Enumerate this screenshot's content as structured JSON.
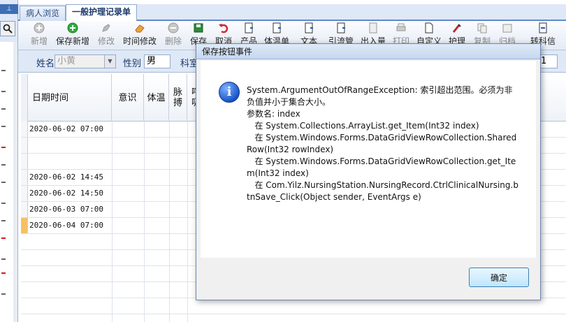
{
  "tabs": [
    {
      "label": "病人浏览"
    },
    {
      "label": "一般护理记录单"
    }
  ],
  "toolbar": [
    {
      "label": "新增",
      "icon": "add-gray-icon",
      "enabled": false
    },
    {
      "label": "保存新增",
      "icon": "add-green-icon",
      "enabled": true
    },
    {
      "label": "修改",
      "icon": "edit-icon",
      "enabled": false
    },
    {
      "label": "时间修改",
      "icon": "eraser-icon",
      "enabled": true
    },
    {
      "label": "删除",
      "icon": "delete-icon",
      "enabled": false
    },
    {
      "label": "保存",
      "icon": "save-icon",
      "enabled": true
    },
    {
      "label": "取消",
      "icon": "undo-icon",
      "enabled": true
    },
    {
      "label": "产品",
      "icon": "product-icon",
      "enabled": true
    },
    {
      "label": "体温单",
      "icon": "temperature-icon",
      "enabled": true
    },
    {
      "label": "文本",
      "icon": "text-icon",
      "enabled": true
    },
    {
      "label": "引流管",
      "icon": "drain-icon",
      "enabled": true
    },
    {
      "label": "出入量",
      "icon": "io-icon",
      "enabled": false
    },
    {
      "label": "打印",
      "icon": "print-icon",
      "enabled": false
    },
    {
      "label": "自定义",
      "icon": "custom-icon",
      "enabled": true
    },
    {
      "label": "护理",
      "icon": "nursing-icon",
      "enabled": true
    },
    {
      "label": "复制",
      "icon": "copy-icon",
      "enabled": false
    },
    {
      "label": "归档",
      "icon": "archive-icon",
      "enabled": false
    },
    {
      "label": "转科信",
      "icon": "transfer-icon",
      "enabled": true
    }
  ],
  "patient": {
    "name_label": "姓名",
    "name_value": "小黄",
    "sex_label": "性别",
    "sex_value": "男",
    "dept_label": "科室",
    "right_value": "1"
  },
  "grid": {
    "columns": [
      "日期时间",
      "意识",
      "体温",
      "脉搏",
      "呼吸"
    ],
    "rows": [
      {
        "datetime": "2020-06-02 07:00"
      },
      {
        "datetime": ""
      },
      {
        "datetime": ""
      },
      {
        "datetime": "2020-06-02 14:45"
      },
      {
        "datetime": "2020-06-02 14:50"
      },
      {
        "datetime": "2020-06-03 07:00"
      },
      {
        "datetime": "2020-06-04 07:00"
      }
    ]
  },
  "dialog": {
    "title": "保存按钮事件",
    "icon": "info-icon",
    "message": "System.ArgumentOutOfRangeException: 索引超出范围。必须为非负值并小于集合大小。\n参数名: index\n   在 System.Collections.ArrayList.get_Item(Int32 index)\n   在 System.Windows.Forms.DataGridViewRowCollection.SharedRow(Int32 rowIndex)\n   在 System.Windows.Forms.DataGridViewRowCollection.get_Item(Int32 index)\n   在 Com.Yilz.NursingStation.NursingRecord.CtrlClinicalNursing.btnSave_Click(Object sender, EventArgs e)",
    "ok_label": "确定"
  },
  "colors": {
    "accent": "#5c8acb",
    "selected_row": "#f6b24a"
  }
}
